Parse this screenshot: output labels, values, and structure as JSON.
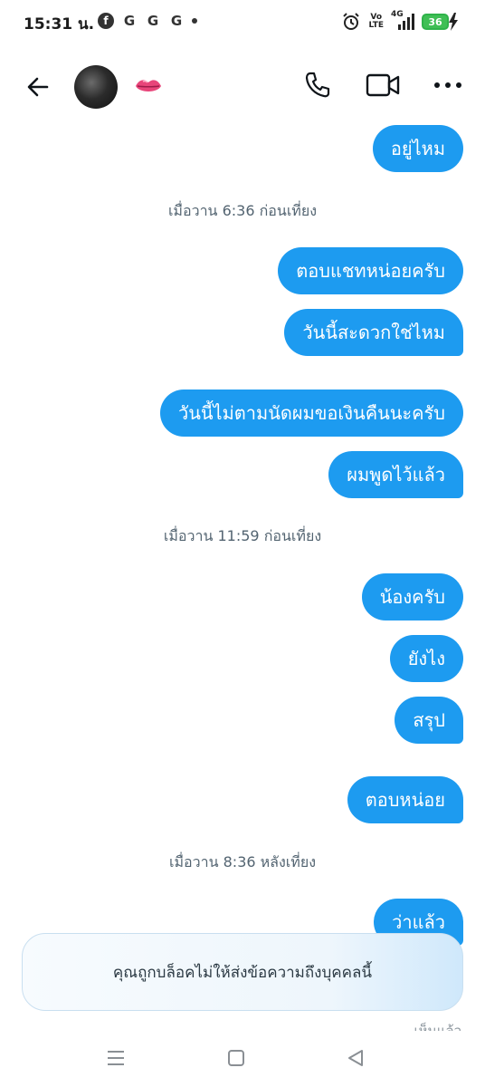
{
  "status_bar": {
    "time": "15:31 น.",
    "notif_fb": "f",
    "notif_g": [
      "G",
      "G",
      "G"
    ],
    "volte_top": "Vo",
    "volte_bottom": "LTE",
    "net": "4G",
    "battery": "36"
  },
  "header": {
    "avatar_alt": "avatar",
    "emoji": "lips"
  },
  "messages": [
    {
      "type": "bubble",
      "text": "อยู่ไหม"
    },
    {
      "type": "timestamp",
      "text": "เมื่อวาน 6:36 ก่อนเที่ยง"
    },
    {
      "type": "bubble",
      "text": "ตอบแชทหน่อยครับ"
    },
    {
      "type": "bubble",
      "text": "วันนี้สะดวกใช่ไหม"
    },
    {
      "type": "bubble",
      "text": "วันนี้ไม่ตามนัดผมขอเงินคืนนะครับ"
    },
    {
      "type": "bubble",
      "text": "ผมพูดไว้แล้ว"
    },
    {
      "type": "timestamp",
      "text": "เมื่อวาน 11:59 ก่อนเที่ยง"
    },
    {
      "type": "bubble",
      "text": "น้องครับ"
    },
    {
      "type": "bubble",
      "text": "ยังไง"
    },
    {
      "type": "bubble",
      "text": "สรุป"
    },
    {
      "type": "bubble",
      "text": "ตอบหน่อย"
    },
    {
      "type": "timestamp",
      "text": "เมื่อวาน 8:36 หลังเที่ยง"
    },
    {
      "type": "bubble",
      "text": "ว่าแล้ว"
    }
  ],
  "seen_label": "เห็นแล้ว",
  "blocked_banner": "คุณถูกบล็อคไม่ให้ส่งข้อความถึงบุคคลนี้",
  "colors": {
    "bubble": "#1d9bf0",
    "timestamp": "#536471",
    "battery": "#3fbf55"
  }
}
